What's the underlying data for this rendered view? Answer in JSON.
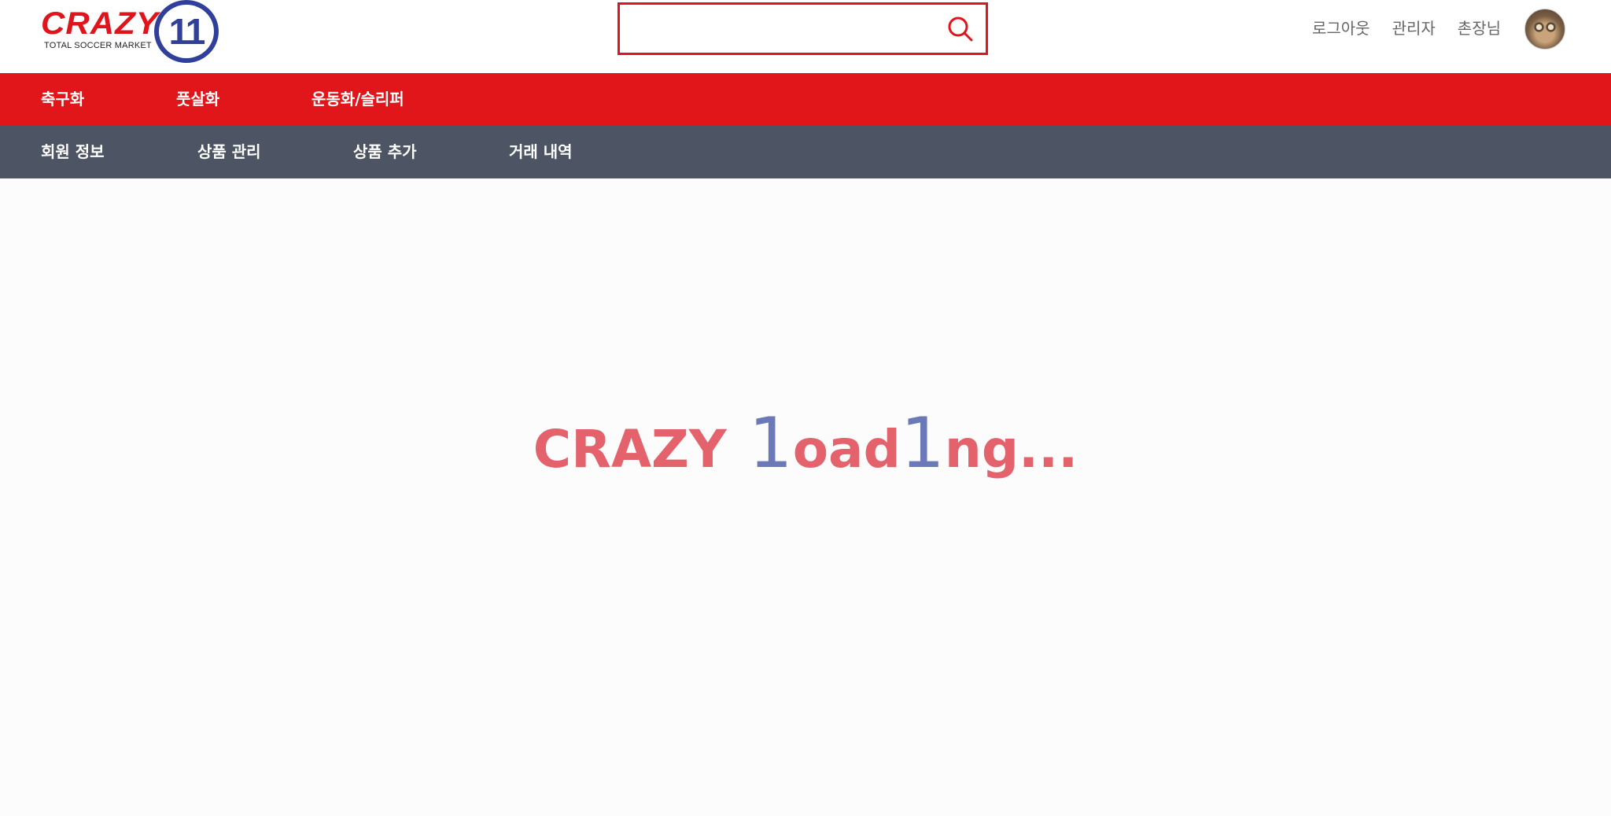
{
  "logo": {
    "wordmark": "CRAZY",
    "badge": "11",
    "tagline": "TOTAL SOCCER MARKET"
  },
  "search": {
    "value": "",
    "placeholder": "",
    "icon": "search-icon",
    "accent_color": "#e0141b"
  },
  "user_menu": {
    "logout": "로그아웃",
    "admin": "관리자",
    "username": "촌장님"
  },
  "main_nav": {
    "items": [
      {
        "label": "축구화"
      },
      {
        "label": "풋살화"
      },
      {
        "label": "운동화/슬리퍼"
      }
    ],
    "color": "#e0161b"
  },
  "admin_nav": {
    "items": [
      {
        "label": "회원 정보"
      },
      {
        "label": "상품 관리"
      },
      {
        "label": "상품 추가"
      },
      {
        "label": "거래 내역"
      }
    ],
    "color": "#4d5564"
  },
  "loading": {
    "part1": "CRAZY",
    "part2": "1",
    "part3": "oad",
    "part4": "1",
    "part5": "ng...",
    "red_color": "#e3626b",
    "blue_color": "#6c79b8"
  }
}
